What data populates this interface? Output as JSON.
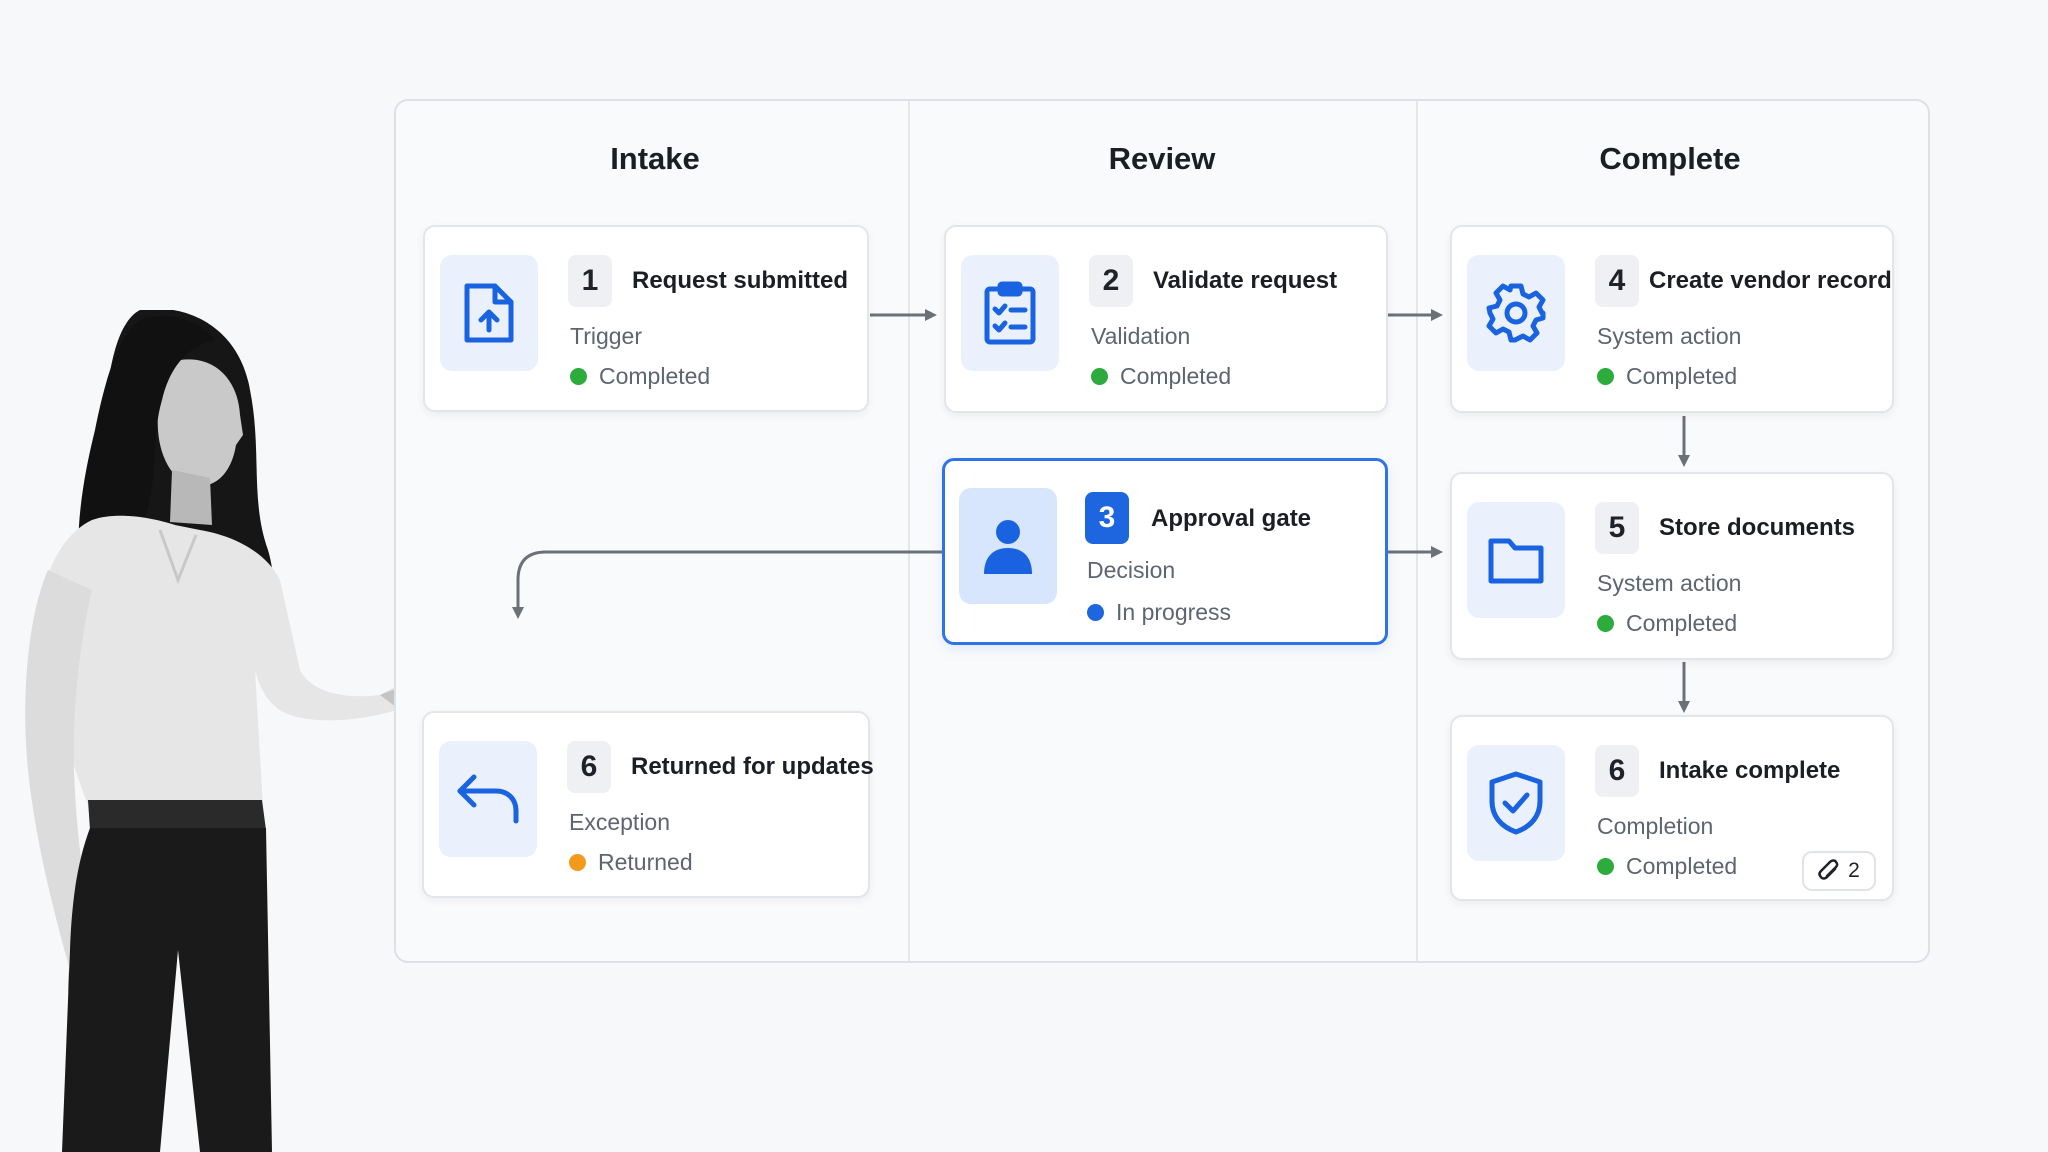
{
  "columns": [
    {
      "title": "Intake"
    },
    {
      "title": "Review"
    },
    {
      "title": "Complete"
    }
  ],
  "steps": [
    {
      "number": "1",
      "title": "Request submitted",
      "type": "Trigger",
      "status": "Completed",
      "status_color": "#2dab3d",
      "icon": "file-upload-icon"
    },
    {
      "number": "2",
      "title": "Validate request",
      "type": "Validation",
      "status": "Completed",
      "status_color": "#2dab3d",
      "icon": "clipboard-checklist-icon"
    },
    {
      "number": "3",
      "title": "Approval gate",
      "type": "Decision",
      "status": "In progress",
      "status_color": "#1e66df",
      "icon": "user-icon"
    },
    {
      "number": "4",
      "title": "Create vendor record",
      "type": "System action",
      "status": "Completed",
      "status_color": "#2dab3d",
      "icon": "gear-icon"
    },
    {
      "number": "5",
      "title": "Store documents",
      "type": "System action",
      "status": "Completed",
      "status_color": "#2dab3d",
      "icon": "folder-icon"
    },
    {
      "number": "6",
      "title": "Intake complete",
      "type": "Completion",
      "status": "Completed",
      "status_color": "#2dab3d",
      "icon": "shield-check-icon",
      "attachments": "2"
    },
    {
      "number": "6",
      "title": "Returned for updates",
      "type": "Exception",
      "status": "Returned",
      "status_color": "#f29a1c",
      "icon": "return-arrow-icon"
    }
  ],
  "colors": {
    "accent": "#1e66df",
    "icon_blue": "#1a63e0",
    "connector": "#6b7079",
    "completed": "#2dab3d",
    "in_progress": "#1e66df",
    "returned": "#f29a1c"
  }
}
